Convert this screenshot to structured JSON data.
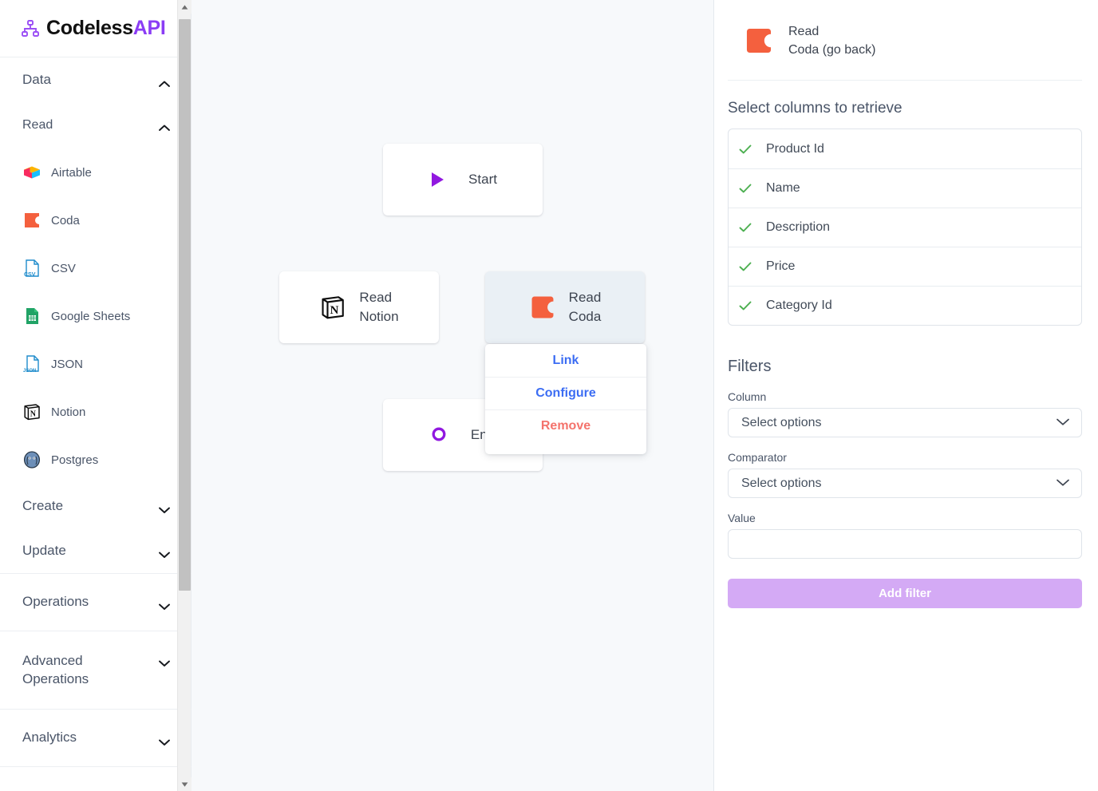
{
  "brand": {
    "name_main": "Codeless",
    "name_accent": "API",
    "icon": "sitemap-icon",
    "accent_color": "#8b3df5"
  },
  "sidebar": {
    "groups": [
      {
        "label": "Data",
        "expanded": true,
        "icon": "chevron-up-icon"
      },
      {
        "label": "Read",
        "expanded": true,
        "icon": "chevron-up-icon"
      },
      {
        "label": "Create",
        "expanded": false,
        "icon": "chevron-down-icon"
      },
      {
        "label": "Update",
        "expanded": false,
        "icon": "chevron-down-icon"
      },
      {
        "label": "Operations",
        "expanded": false,
        "icon": "chevron-down-icon"
      },
      {
        "label": "Advanced Operations",
        "expanded": false,
        "icon": "chevron-down-icon"
      },
      {
        "label": "Analytics",
        "expanded": false,
        "icon": "chevron-down-icon"
      }
    ],
    "read_sources": [
      {
        "label": "Airtable",
        "icon": "airtable-icon"
      },
      {
        "label": "Coda",
        "icon": "coda-icon"
      },
      {
        "label": "CSV",
        "icon": "csv-file-icon"
      },
      {
        "label": "Google Sheets",
        "icon": "google-sheets-icon"
      },
      {
        "label": "JSON",
        "icon": "json-file-icon"
      },
      {
        "label": "Notion",
        "icon": "notion-icon"
      },
      {
        "label": "Postgres",
        "icon": "postgres-icon"
      }
    ]
  },
  "canvas": {
    "nodes": [
      {
        "id": "start",
        "line1": "Start",
        "line2": "",
        "icon": "play-triangle-icon",
        "selected": false
      },
      {
        "id": "read-notion",
        "line1": "Read",
        "line2": "Notion",
        "icon": "notion-icon",
        "selected": false
      },
      {
        "id": "read-coda",
        "line1": "Read",
        "line2": "Coda",
        "icon": "coda-icon",
        "selected": true
      },
      {
        "id": "end",
        "line1": "End",
        "line2": "",
        "icon": "circle-outline-icon",
        "selected": false
      }
    ],
    "context_menu": [
      {
        "label": "Link",
        "style": "blue"
      },
      {
        "label": "Configure",
        "style": "blue"
      },
      {
        "label": "Remove",
        "style": "red"
      }
    ]
  },
  "panel": {
    "header": {
      "line1": "Read",
      "line2": "Coda (go back)",
      "icon": "coda-icon"
    },
    "columns_title": "Select columns to retrieve",
    "columns": [
      {
        "label": "Product Id",
        "checked": true
      },
      {
        "label": "Name",
        "checked": true
      },
      {
        "label": "Description",
        "checked": true
      },
      {
        "label": "Price",
        "checked": true
      },
      {
        "label": "Category Id",
        "checked": true
      }
    ],
    "filters_title": "Filters",
    "fields": {
      "column_label": "Column",
      "column_value": "Select options",
      "comparator_label": "Comparator",
      "comparator_value": "Select options",
      "value_label": "Value",
      "value_value": "",
      "value_placeholder": ""
    },
    "add_filter_label": "Add filter",
    "accent_button_color": "#d4aaf5",
    "check_color": "#4CAF50"
  }
}
